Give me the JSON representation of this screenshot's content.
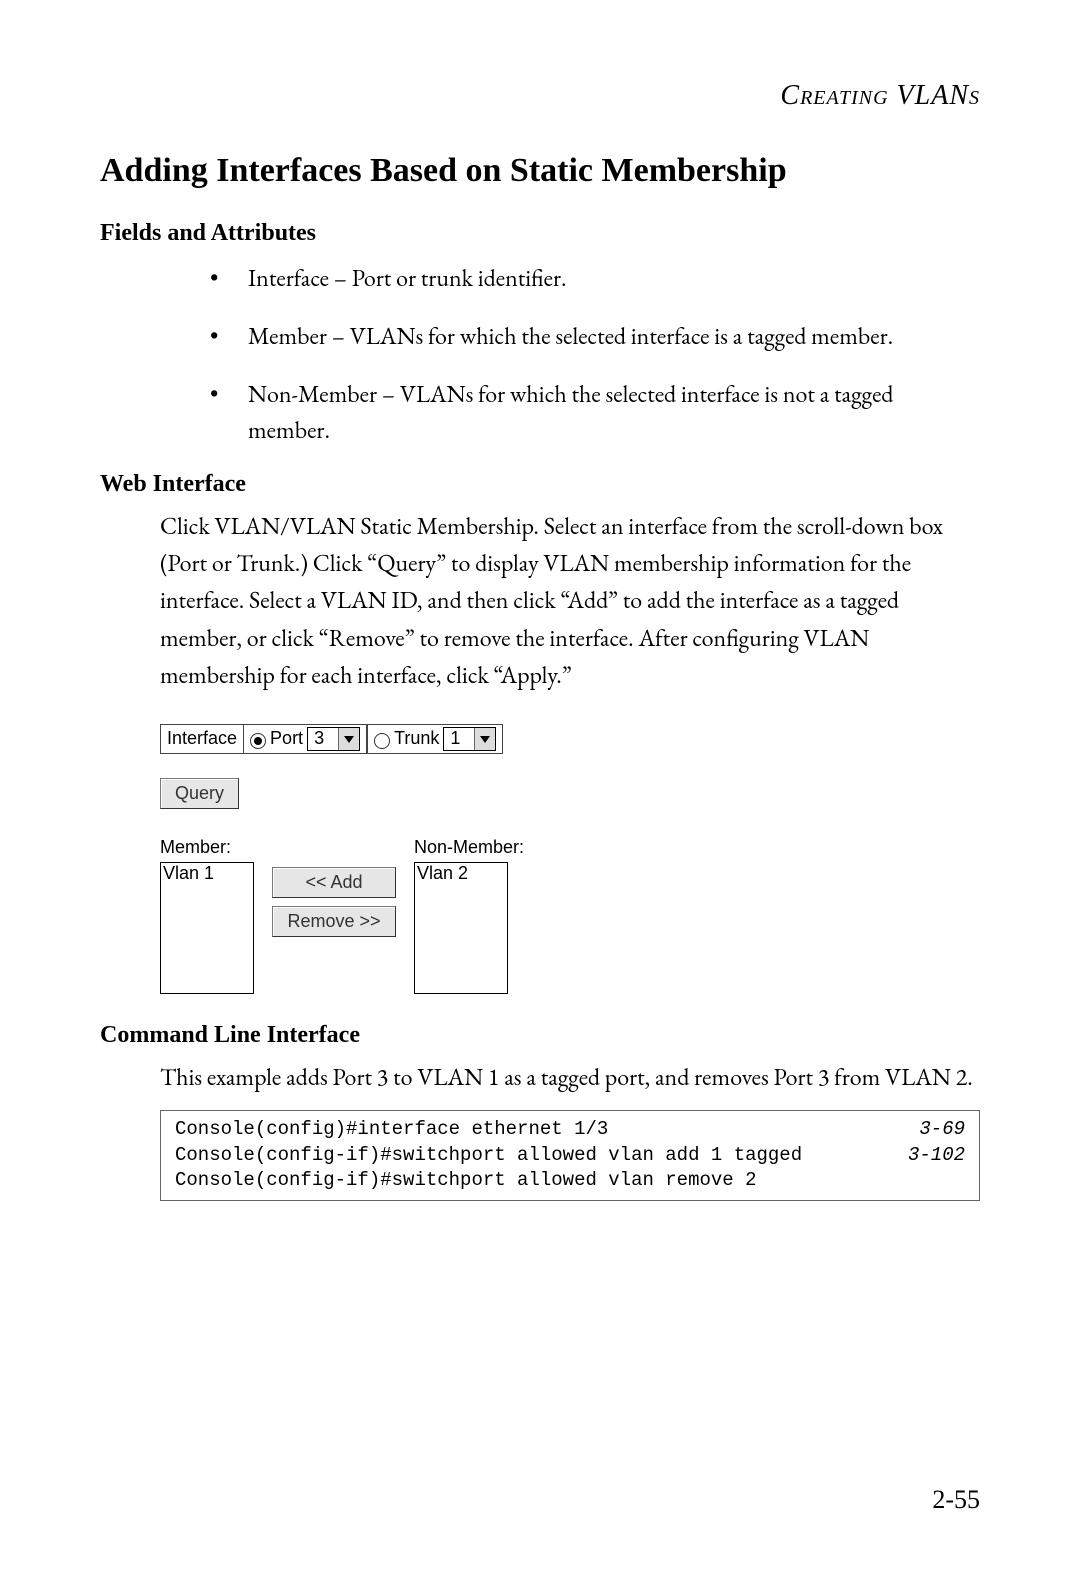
{
  "header": {
    "running_head": "Creating VLANs"
  },
  "title": "Adding Interfaces Based on Static Membership",
  "fields_heading": "Fields and Attributes",
  "fields": [
    "Interface – Port or trunk identifier.",
    "Member – VLANs for which the selected interface is a tagged member.",
    "Non-Member – VLANs for which the selected interface is not a tagged member."
  ],
  "web_heading": "Web Interface",
  "web_para": "Click VLAN/VLAN Static Membership. Select an interface from the scroll-down box (Port or Trunk.) Click “Query” to display VLAN membership information for the interface. Select a VLAN ID, and then click “Add” to add the interface as a tagged member, or click “Remove” to remove the interface. After configuring VLAN membership for each interface, click “Apply.”",
  "ui": {
    "interface_label": "Interface",
    "port_label": "Port",
    "port_value": "3",
    "trunk_label": "Trunk",
    "trunk_value": "1",
    "query_label": "Query",
    "member_label": "Member:",
    "nonmember_label": "Non-Member:",
    "member_item": "Vlan 1",
    "nonmember_item": "Vlan 2",
    "add_label": "<< Add",
    "remove_label": "Remove >>"
  },
  "cli_heading": "Command Line Interface",
  "cli_para": "This example adds Port 3 to VLAN 1 as a tagged port, and removes Port 3 from VLAN 2.",
  "cli": {
    "lines": [
      {
        "cmd": "Console(config)#interface ethernet 1/3",
        "ref": "3-69"
      },
      {
        "cmd": "Console(config-if)#switchport allowed vlan add 1 tagged",
        "ref": "3-102"
      },
      {
        "cmd": "Console(config-if)#switchport allowed vlan remove 2",
        "ref": ""
      }
    ]
  },
  "page_number": "2-55"
}
